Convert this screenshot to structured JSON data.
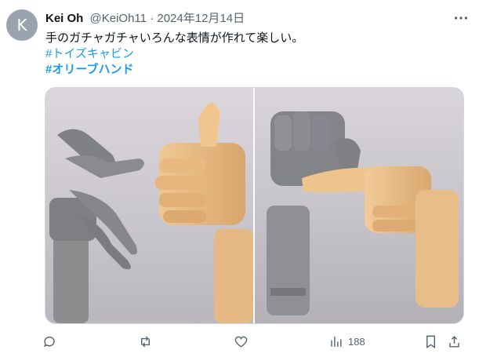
{
  "tweet": {
    "avatar_letter": "K",
    "author_name": "Kei Oh",
    "handle": "@KeiOh11",
    "separator": "·",
    "date": "2024年12月14日",
    "text": "手のガチャガチャいろんな表情が作れて楽しい。",
    "hashtags": [
      "#トイズキャビン",
      "#オリーブハンド"
    ],
    "media": [
      {
        "alt": "gray hand and tan hand figures"
      },
      {
        "alt": "gray and tan hand figures pointing"
      }
    ],
    "stats": {
      "views": "188"
    }
  },
  "colors": {
    "link": "#1d9bf0",
    "muted": "#536471",
    "text": "#0f1419"
  },
  "icons": [
    "more-icon",
    "reply-icon",
    "retweet-icon",
    "like-icon",
    "views-icon",
    "bookmark-icon",
    "share-icon"
  ]
}
